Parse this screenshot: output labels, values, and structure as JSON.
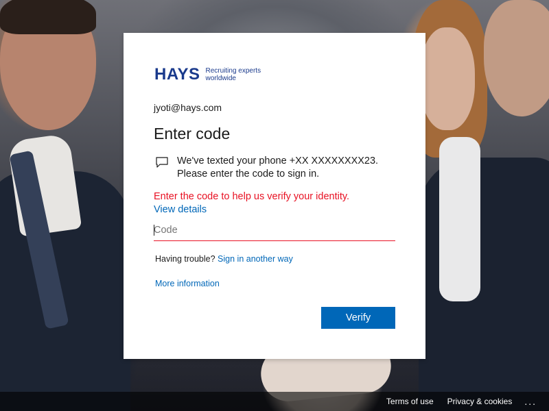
{
  "logo": {
    "brand": "HAYS",
    "tagline_line1": "Recruiting experts",
    "tagline_line2": "worldwide"
  },
  "identity": "jyoti@hays.com",
  "title": "Enter code",
  "message": {
    "icon": "sms-message-icon",
    "line1": "We've texted your phone +XX XXXXXXXX23.",
    "line2": "Please enter the code to sign in."
  },
  "error_text": "Enter the code to help us verify your identity.",
  "view_details": "View details",
  "code_input": {
    "placeholder": "Code",
    "value": ""
  },
  "trouble": {
    "prefix": "Having trouble?",
    "link": "Sign in another way"
  },
  "more_info": "More information",
  "verify_label": "Verify",
  "footer": {
    "terms": "Terms of use",
    "privacy": "Privacy & cookies",
    "more": "..."
  },
  "colors": {
    "brand_blue": "#1a3a8c",
    "link_blue": "#0067b8",
    "error_red": "#e81123",
    "button_blue": "#0067b8"
  }
}
